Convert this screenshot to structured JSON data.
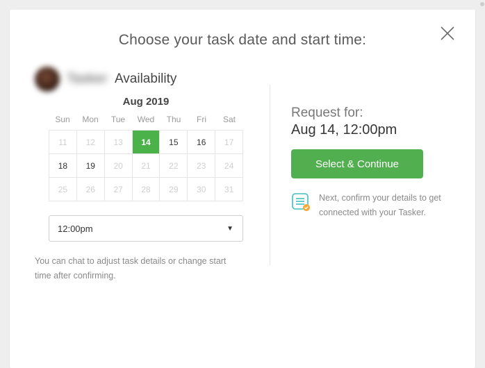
{
  "modal": {
    "title": "Choose your task date and start time:",
    "tasker_name": "Tasker",
    "availability_label": "Availability",
    "month_label": "Aug 2019",
    "dow": [
      "Sun",
      "Mon",
      "Tue",
      "Wed",
      "Thu",
      "Fri",
      "Sat"
    ],
    "weeks": [
      [
        {
          "n": "11",
          "available": false,
          "selected": false
        },
        {
          "n": "12",
          "available": false,
          "selected": false
        },
        {
          "n": "13",
          "available": false,
          "selected": false
        },
        {
          "n": "14",
          "available": true,
          "selected": true
        },
        {
          "n": "15",
          "available": true,
          "selected": false
        },
        {
          "n": "16",
          "available": true,
          "selected": false
        },
        {
          "n": "17",
          "available": false,
          "selected": false
        }
      ],
      [
        {
          "n": "18",
          "available": true,
          "selected": false
        },
        {
          "n": "19",
          "available": true,
          "selected": false
        },
        {
          "n": "20",
          "available": false,
          "selected": false
        },
        {
          "n": "21",
          "available": false,
          "selected": false
        },
        {
          "n": "22",
          "available": false,
          "selected": false
        },
        {
          "n": "23",
          "available": false,
          "selected": false
        },
        {
          "n": "24",
          "available": false,
          "selected": false
        }
      ],
      [
        {
          "n": "25",
          "available": false,
          "selected": false
        },
        {
          "n": "26",
          "available": false,
          "selected": false
        },
        {
          "n": "27",
          "available": false,
          "selected": false
        },
        {
          "n": "28",
          "available": false,
          "selected": false
        },
        {
          "n": "29",
          "available": false,
          "selected": false
        },
        {
          "n": "30",
          "available": false,
          "selected": false
        },
        {
          "n": "31",
          "available": false,
          "selected": false
        }
      ]
    ],
    "time_selected": "12:00pm",
    "hint": "You can chat to adjust task details or change start time after confirming.",
    "request_label": "Request for:",
    "request_value": "Aug 14, 12:00pm",
    "cta_label": "Select & Continue",
    "next_text": "Next, confirm your details to get connected with your Tasker."
  }
}
